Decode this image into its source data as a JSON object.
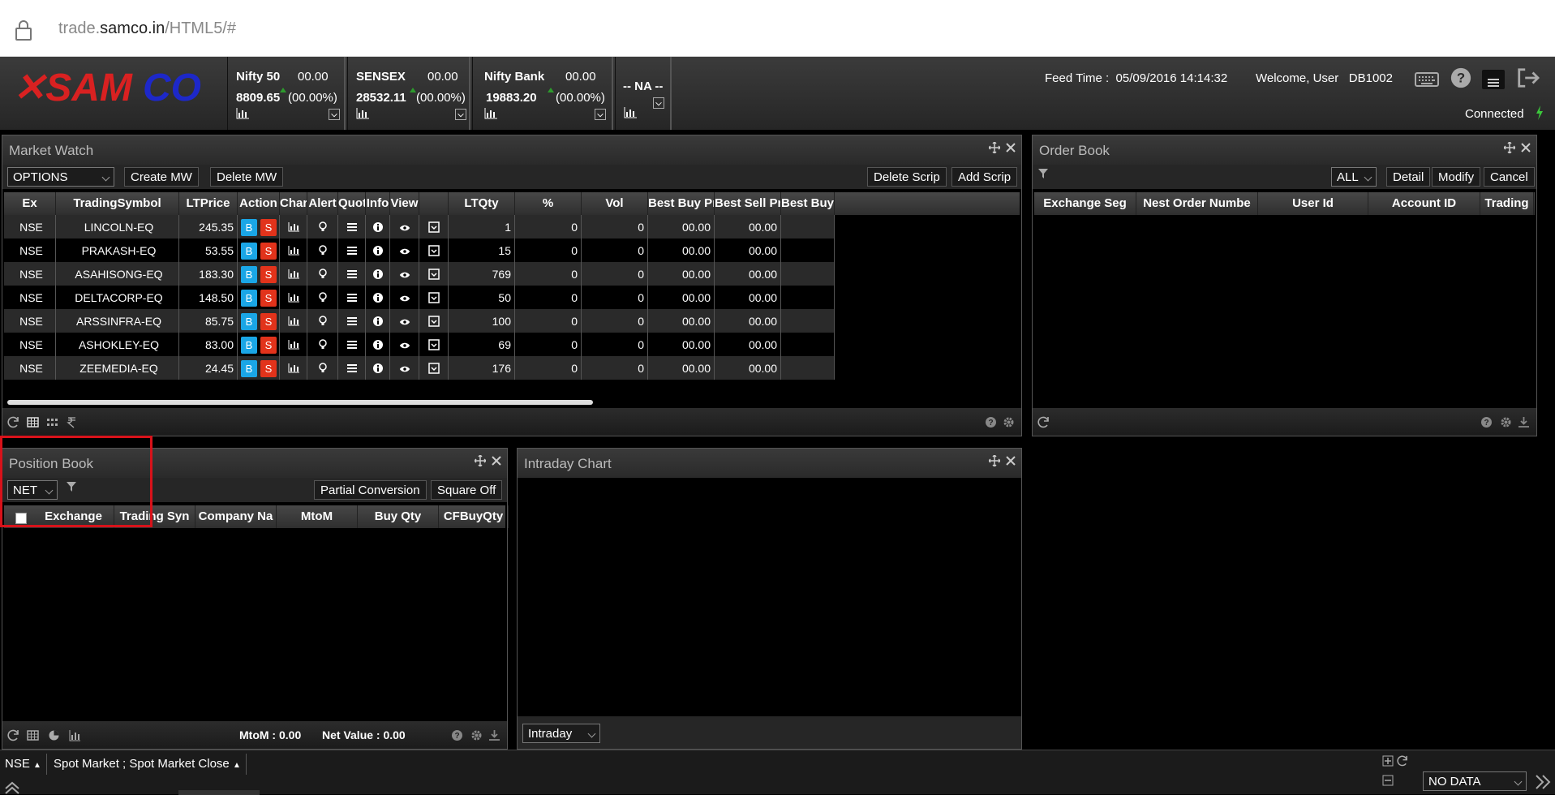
{
  "browser": {
    "url_domain": "trade.samco.in",
    "url_path": "/HTML5/#",
    "url_pre": "trade."
  },
  "header": {
    "logo_text": "SAMCO",
    "indices": [
      {
        "name": "Nifty 50",
        "change": "00.00",
        "value": "8809.65",
        "pct": "(00.00%)"
      },
      {
        "name": "SENSEX",
        "change": "00.00",
        "value": "28532.11",
        "pct": "(00.00%)"
      },
      {
        "name": "Nifty Bank",
        "change": "00.00",
        "value": "19883.20",
        "pct": "(00.00%)"
      },
      {
        "name": "-- NA --"
      }
    ],
    "feed_label": "Feed Time :",
    "feed_time": "05/09/2016 14:14:32",
    "welcome": "Welcome, User",
    "user_id": "DB1002",
    "connection": "Connected"
  },
  "market_watch": {
    "title": "Market Watch",
    "watchlist": "OPTIONS",
    "create_label": "Create MW",
    "delete_label": "Delete MW",
    "delete_scrip_label": "Delete Scrip",
    "add_scrip_label": "Add Scrip",
    "columns": [
      "Ex",
      "TradingSymbol",
      "LTPrice",
      "Action",
      "Char",
      "Alert",
      "Quot",
      "Info",
      "View",
      "",
      "LTQty",
      "%",
      "Vol",
      "Best Buy Pr",
      "Best Sell Pr",
      "Best Buy"
    ],
    "buy_label": "B",
    "sell_label": "S",
    "rows": [
      {
        "ex": "NSE",
        "symbol": "LINCOLN-EQ",
        "ltp": "245.35",
        "ltqty": "1",
        "pct": "0",
        "vol": "0",
        "bbp": "00.00",
        "bsp": "00.00"
      },
      {
        "ex": "NSE",
        "symbol": "PRAKASH-EQ",
        "ltp": "53.55",
        "ltqty": "15",
        "pct": "0",
        "vol": "0",
        "bbp": "00.00",
        "bsp": "00.00"
      },
      {
        "ex": "NSE",
        "symbol": "ASAHISONG-EQ",
        "ltp": "183.30",
        "ltqty": "769",
        "pct": "0",
        "vol": "0",
        "bbp": "00.00",
        "bsp": "00.00"
      },
      {
        "ex": "NSE",
        "symbol": "DELTACORP-EQ",
        "ltp": "148.50",
        "ltqty": "50",
        "pct": "0",
        "vol": "0",
        "bbp": "00.00",
        "bsp": "00.00"
      },
      {
        "ex": "NSE",
        "symbol": "ARSSINFRA-EQ",
        "ltp": "85.75",
        "ltqty": "100",
        "pct": "0",
        "vol": "0",
        "bbp": "00.00",
        "bsp": "00.00"
      },
      {
        "ex": "NSE",
        "symbol": "ASHOKLEY-EQ",
        "ltp": "83.00",
        "ltqty": "69",
        "pct": "0",
        "vol": "0",
        "bbp": "00.00",
        "bsp": "00.00"
      },
      {
        "ex": "NSE",
        "symbol": "ZEEMEDIA-EQ",
        "ltp": "24.45",
        "ltqty": "176",
        "pct": "0",
        "vol": "0",
        "bbp": "00.00",
        "bsp": "00.00"
      }
    ]
  },
  "order_book": {
    "title": "Order Book",
    "filter": "ALL",
    "detail_label": "Detail",
    "modify_label": "Modify",
    "cancel_label": "Cancel",
    "columns": [
      "Exchange Seg",
      "Nest Order Numbe",
      "User Id",
      "Account ID",
      "Trading"
    ]
  },
  "position_book": {
    "title": "Position Book",
    "filter": "NET",
    "partial_label": "Partial Conversion",
    "square_label": "Square Off",
    "columns": [
      "Exchange",
      "Trading Syn",
      "Company Na",
      "MtoM",
      "Buy Qty",
      "CFBuyQty"
    ],
    "mtom": "MtoM : 0.00",
    "net_value": "Net Value : 0.00"
  },
  "intraday_chart": {
    "title": "Intraday Chart",
    "period": "Intraday"
  },
  "status_bar": {
    "exchange": "NSE",
    "market_status": "Spot Market ; Spot Market Close",
    "data_select": "NO DATA"
  },
  "colors": {
    "buy": "#1aa6e6",
    "sell": "#e2331b",
    "highlight": "#d8121a",
    "connected": "#3cc93c"
  }
}
